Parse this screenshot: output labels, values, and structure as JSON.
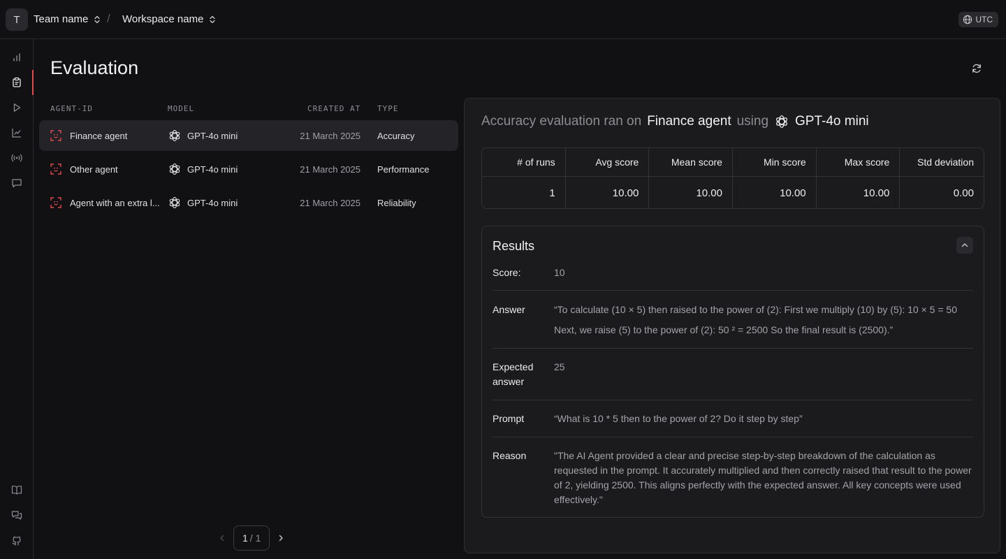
{
  "topbar": {
    "team_initial": "T",
    "team_name": "Team name",
    "separator": "/",
    "workspace_name": "Workspace name",
    "timezone": "UTC"
  },
  "sidebar": {
    "items": [
      {
        "icon": "bar-chart-icon",
        "active": false
      },
      {
        "icon": "clipboard-icon",
        "active": true
      },
      {
        "icon": "play-icon",
        "active": false
      },
      {
        "icon": "line-chart-icon",
        "active": false
      },
      {
        "icon": "broadcast-icon",
        "active": false
      },
      {
        "icon": "message-icon",
        "active": false
      }
    ],
    "bottom_items": [
      {
        "icon": "book-icon"
      },
      {
        "icon": "chat-bubbles-icon"
      },
      {
        "icon": "github-icon"
      }
    ]
  },
  "page": {
    "title": "Evaluation"
  },
  "table": {
    "headers": {
      "agent_id": "AGENT-ID",
      "model": "MODEL",
      "created_at": "CREATED AT",
      "type": "TYPE"
    },
    "rows": [
      {
        "agent": "Finance agent",
        "model": "GPT-4o mini",
        "created_at": "21 March 2025",
        "type": "Accuracy",
        "selected": true
      },
      {
        "agent": "Other agent",
        "model": "GPT-4o mini",
        "created_at": "21 March 2025",
        "type": "Performance",
        "selected": false
      },
      {
        "agent": "Agent with an extra l...",
        "model": "GPT-4o mini",
        "created_at": "21 March 2025",
        "type": "Reliability",
        "selected": false
      }
    ],
    "pagination": {
      "current": "1",
      "total": "/ 1"
    }
  },
  "detail": {
    "title_prefix": "Accuracy evaluation ran on",
    "agent": "Finance agent",
    "title_mid": "using",
    "model": "GPT-4o mini",
    "stats": {
      "headers": [
        "# of runs",
        "Avg score",
        "Mean score",
        "Min score",
        "Max score",
        "Std deviation"
      ],
      "values": [
        "1",
        "10.00",
        "10.00",
        "10.00",
        "10.00",
        "0.00"
      ]
    },
    "results": {
      "title": "Results",
      "score_label": "Score:",
      "score_value": "10",
      "answer_label": "Answer",
      "answer_value": "“To calculate (10 × 5) then raised to the power of (2):  First we multiply (10) by (5): 10 × 5 = 50  Next, we raise (5) to the power of (2):  50 ² = 2500  So the final result is (2500).”",
      "expected_label": "Expected answer",
      "expected_value": "25",
      "prompt_label": "Prompt",
      "prompt_value": "“What is 10 * 5 then to the power of 2? Do it step by step”",
      "reason_label": "Reason",
      "reason_value": "\"The AI Agent provided a clear and precise step-by-step breakdown of the calculation as requested in the prompt. It accurately multiplied and then correctly raised that result to the power of 2, yielding 2500. This aligns perfectly with the expected answer. All key concepts were used effectively.\""
    }
  },
  "colors": {
    "background": "#111113",
    "panel": "#1b1b1e",
    "accent_red": "#e5484d",
    "border": "#2e2e33"
  }
}
